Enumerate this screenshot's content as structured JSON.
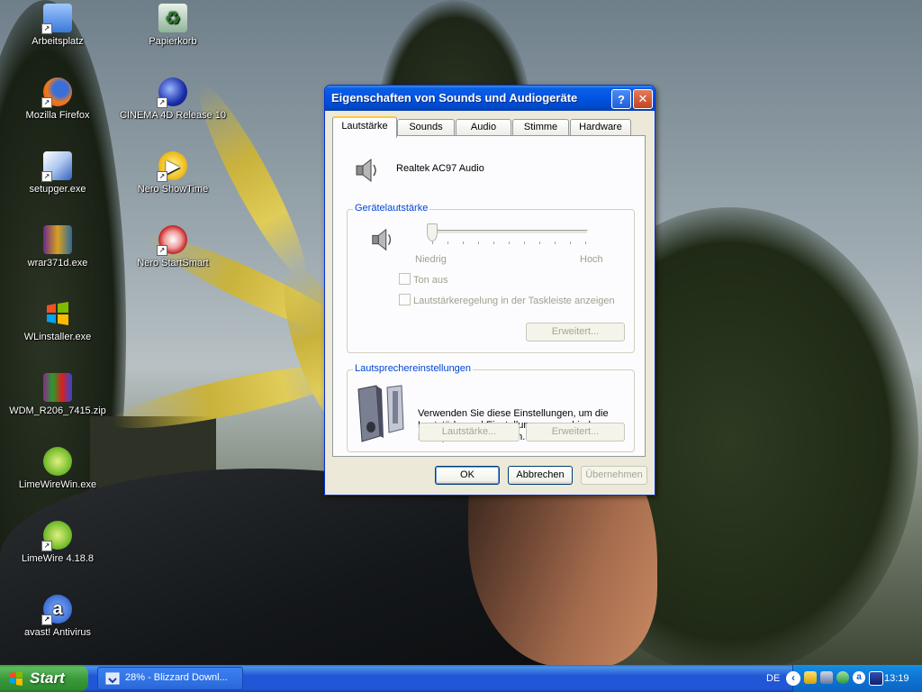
{
  "desktop": {
    "icons": [
      {
        "label": "Arbeitsplatz",
        "icon": "computer-icon"
      },
      {
        "label": "Papierkorb",
        "icon": "recycle-bin-icon"
      },
      {
        "label": "Mozilla Firefox",
        "icon": "firefox-icon"
      },
      {
        "label": "CINEMA 4D Release 10",
        "icon": "cinema4d-icon"
      },
      {
        "label": "setupger.exe",
        "icon": "setup-icon"
      },
      {
        "label": "Nero ShowTime",
        "icon": "nero-showtime-icon"
      },
      {
        "label": "wrar371d.exe",
        "icon": "winrar-icon"
      },
      {
        "label": "Nero StartSmart",
        "icon": "nero-startsmart-icon"
      },
      {
        "label": "WLinstaller.exe",
        "icon": "windows-logo-icon"
      },
      {
        "label": "WDM_R206_7415.zip",
        "icon": "zip-archive-icon"
      },
      {
        "label": "LimeWireWin.exe",
        "icon": "limewire-icon"
      },
      {
        "label": "LimeWire 4.18.8",
        "icon": "limewire-icon"
      },
      {
        "label": "avast! Antivirus",
        "icon": "avast-icon"
      }
    ]
  },
  "dialog": {
    "title": "Eigenschaften von Sounds und Audiogeräte",
    "tabs": [
      "Lautstärke",
      "Sounds",
      "Audio",
      "Stimme",
      "Hardware"
    ],
    "device_name": "Realtek AC97 Audio",
    "device_volume": {
      "group_label": "Gerätelautstärke",
      "low_label": "Niedrig",
      "high_label": "Hoch",
      "mute_label": "Ton aus",
      "taskbar_label": "Lautstärkeregelung in der Taskleiste anzeigen",
      "advanced_label": "Erweitert...",
      "level": 0
    },
    "speakers": {
      "group_label": "Lautsprechereinstellungen",
      "description": "Verwenden Sie diese Einstellungen, um die Lautstärke und Einstellungen verschiedener Lautsprecher zu ändern.",
      "volume_button": "Lautstärke...",
      "advanced_button": "Erweitert..."
    },
    "buttons": {
      "ok": "OK",
      "cancel": "Abbrechen",
      "apply": "Übernehmen"
    },
    "help_glyph": "?",
    "close_glyph": "✕"
  },
  "taskbar": {
    "start_label": "Start",
    "task_label": "28% - Blizzard Downl...",
    "language": "DE",
    "clock": "13:19"
  },
  "colors": {
    "title_blue": "#0054e3",
    "taskbar_blue": "#2157d7",
    "start_green": "#3a9a3a",
    "group_label_blue": "#0046d5"
  }
}
